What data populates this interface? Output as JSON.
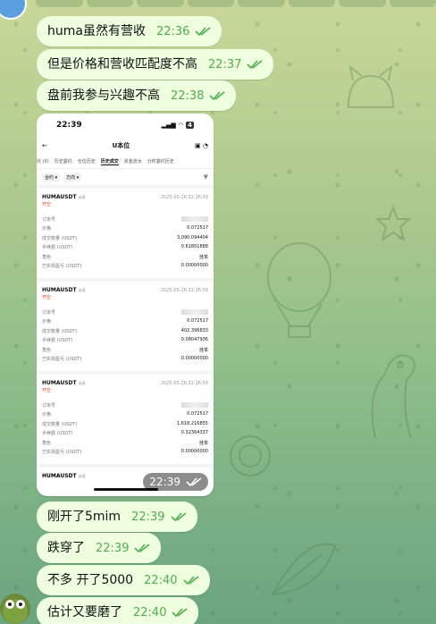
{
  "colors": {
    "bubble_bg": "#eefedf",
    "time_color": "#4fae4e",
    "sell_color": "#e04a3a"
  },
  "messages_top": [
    {
      "text": "huma虽然有营收",
      "time": "22:36"
    },
    {
      "text": "但是价格和营收匹配度不高",
      "time": "22:37"
    },
    {
      "text": "盘前我参与兴趣不高",
      "time": "22:38"
    }
  ],
  "photo": {
    "time": "22:39",
    "status_time": "22:39",
    "battery": "4",
    "nav_title": "U本位",
    "tabs": [
      "托 (0)",
      "历史委托",
      "仓位历史",
      "历史成交",
      "资金流水",
      "分时委托历史"
    ],
    "active_tab": "历史成交",
    "filters": [
      "合约",
      "方向"
    ],
    "labels": {
      "order_id": "订单号",
      "price": "价格",
      "qty": "成交数量 (USDT)",
      "fee": "手续费 (USDT)",
      "role": "角色",
      "pnl": "已实现盈亏 (USDT)"
    },
    "trades": [
      {
        "symbol": "HUMAUSDT",
        "tag": "永续",
        "date": "2025-05-26 22:26:58",
        "side": "开空",
        "price": "0.072517",
        "qty": "3,090.094404",
        "fee": "0.61801888",
        "role": "挂单",
        "pnl": "0.00000000"
      },
      {
        "symbol": "HUMAUSDT",
        "tag": "永续",
        "date": "2025-05-26 22:26:58",
        "side": "开空",
        "price": "0.072517",
        "qty": "402.396833",
        "fee": "0.08047936",
        "role": "挂单",
        "pnl": "0.00000000"
      },
      {
        "symbol": "HUMAUSDT",
        "tag": "永续",
        "date": "2025-05-26 22:26:58",
        "side": "开空",
        "price": "0.072517",
        "qty": "1,618.216855",
        "fee": "0.32364337",
        "role": "挂单",
        "pnl": "0.00000000"
      }
    ],
    "last_symbol": "HUMAUSDT",
    "last_tag": "永续"
  },
  "messages_bottom": [
    {
      "text": "刚开了5mim",
      "time": "22:39"
    },
    {
      "text": "跌穿了",
      "time": "22:39"
    },
    {
      "text": "不多 开了5000",
      "time": "22:40"
    },
    {
      "text": "估计又要磨了",
      "time": "22:40"
    }
  ]
}
